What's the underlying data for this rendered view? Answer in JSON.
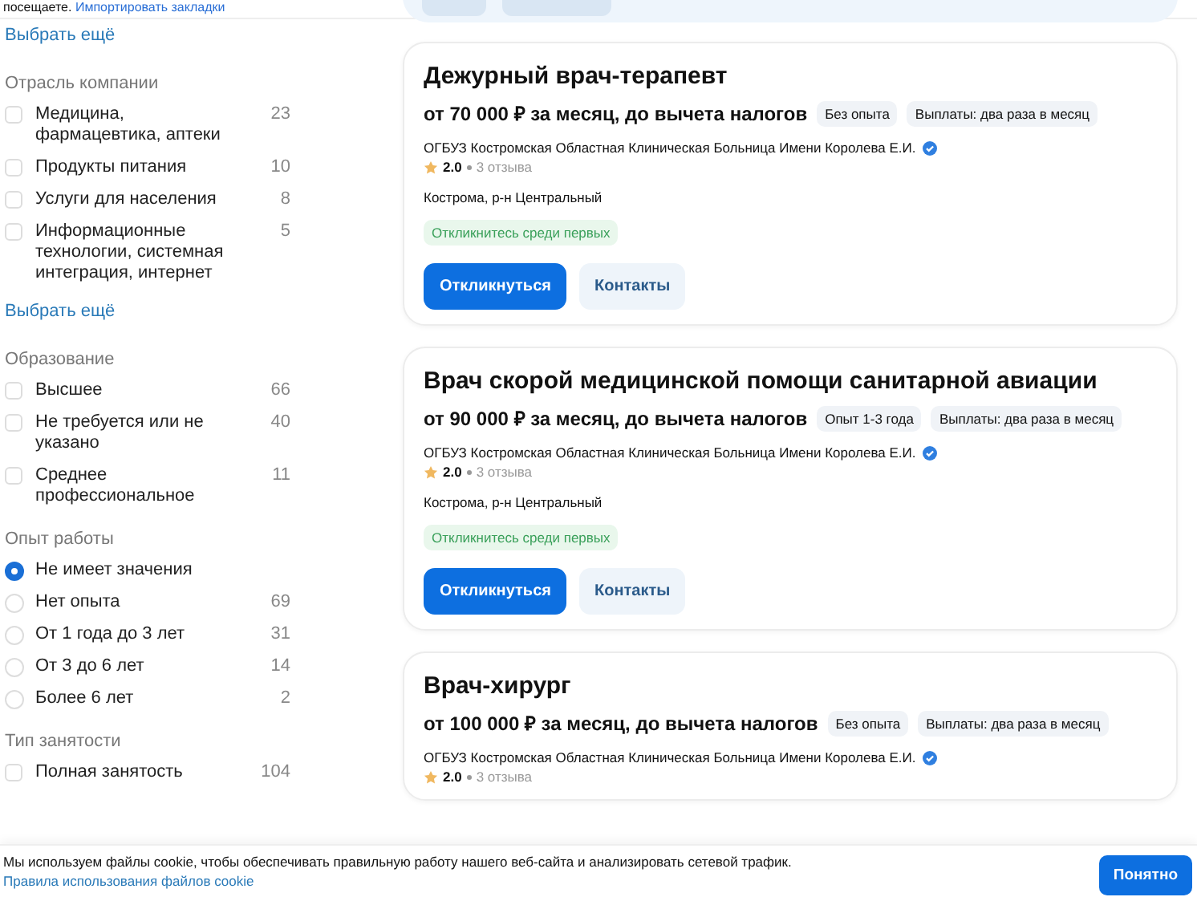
{
  "top_notice": {
    "text": "посещаете.",
    "link": "Импортировать закладки"
  },
  "sidebar": {
    "more_link_top": "Выбрать ещё",
    "sections": [
      {
        "title": "Отрасль компании",
        "kind": "checkbox",
        "more_link": "Выбрать ещё",
        "options": [
          {
            "label": "Медицина, фармацевтика, аптеки",
            "count": "23",
            "checked": false
          },
          {
            "label": "Продукты питания",
            "count": "10",
            "checked": false
          },
          {
            "label": "Услуги для населения",
            "count": "8",
            "checked": false
          },
          {
            "label": "Информационные технологии, системная интеграция, интернет",
            "count": "5",
            "checked": false
          }
        ]
      },
      {
        "title": "Образование",
        "kind": "checkbox",
        "options": [
          {
            "label": "Высшее",
            "count": "66",
            "checked": false
          },
          {
            "label": "Не требуется или не указано",
            "count": "40",
            "checked": false
          },
          {
            "label": "Среднее профессиональное",
            "count": "11",
            "checked": false
          }
        ]
      },
      {
        "title": "Опыт работы",
        "kind": "radio",
        "options": [
          {
            "label": "Не имеет значения",
            "selected": true
          },
          {
            "label": "Нет опыта",
            "count": "69",
            "selected": false
          },
          {
            "label": "От 1 года до 3 лет",
            "count": "31",
            "selected": false
          },
          {
            "label": "От 3 до 6 лет",
            "count": "14",
            "selected": false
          },
          {
            "label": "Более 6 лет",
            "count": "2",
            "selected": false
          }
        ]
      },
      {
        "title": "Тип занятости",
        "kind": "checkbox",
        "options": [
          {
            "label": "Полная занятость",
            "count": "104",
            "checked": false
          }
        ]
      }
    ]
  },
  "vacancies": [
    {
      "title": "Дежурный врач-терапевт",
      "salary": "от 70 000 ₽ за месяц, до вычета налогов",
      "tags": [
        "Без опыта",
        "Выплаты: два раза в месяц"
      ],
      "employer": "ОГБУЗ Костромская Областная Клиническая Больница Имени Королева Е.И.",
      "verified": true,
      "rating": "2.0",
      "reviews": "3 отзыва",
      "location": "Кострома, р-н Центральный",
      "badge": "Откликнитесь среди первых",
      "apply_button": "Откликнуться",
      "contacts_button": "Контакты"
    },
    {
      "title": "Врач скорой медицинской помощи санитарной авиации",
      "salary": "от 90 000 ₽ за месяц, до вычета налогов",
      "tags": [
        "Опыт 1-3 года",
        "Выплаты: два раза в месяц"
      ],
      "employer": "ОГБУЗ Костромская Областная Клиническая Больница Имени Королева Е.И.",
      "verified": true,
      "rating": "2.0",
      "reviews": "3 отзыва",
      "location": "Кострома, р-н Центральный",
      "badge": "Откликнитесь среди первых",
      "apply_button": "Откликнуться",
      "contacts_button": "Контакты"
    },
    {
      "title": "Врач-хирург",
      "salary": "от 100 000 ₽ за месяц, до вычета налогов",
      "tags": [
        "Без опыта",
        "Выплаты: два раза в месяц"
      ],
      "employer": "ОГБУЗ Костромская Областная Клиническая Больница Имени Королева Е.И.",
      "verified": true,
      "rating": "2.0",
      "reviews": "3 отзыва"
    }
  ],
  "cookie_banner": {
    "text": "Мы используем файлы cookie, чтобы обеспечивать правильную работу нашего веб-сайта и анализировать сетевой трафик.",
    "link": "Правила использования файлов cookie",
    "button": "Понятно"
  }
}
